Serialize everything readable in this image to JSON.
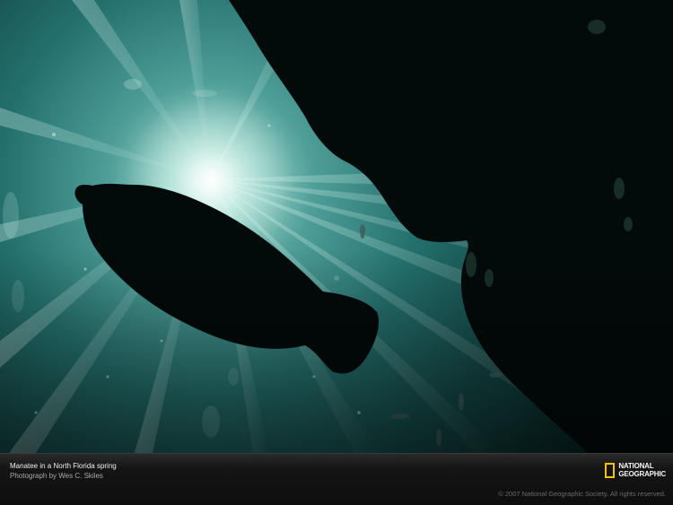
{
  "caption": {
    "title": "Manatee in a North Florida spring",
    "credit": "Photograph by Wes C. Skiles"
  },
  "logo": {
    "line1": "NATIONAL",
    "line2": "GEOGRAPHIC",
    "frame_color": "#f2c500"
  },
  "copyright": "© 2007 National Geographic Society. All rights reserved.",
  "colors": {
    "water_light": "#d8f2ea",
    "water_mid": "#2f7f7a",
    "water_deep": "#06201f",
    "silhouette": "#030a0a"
  }
}
